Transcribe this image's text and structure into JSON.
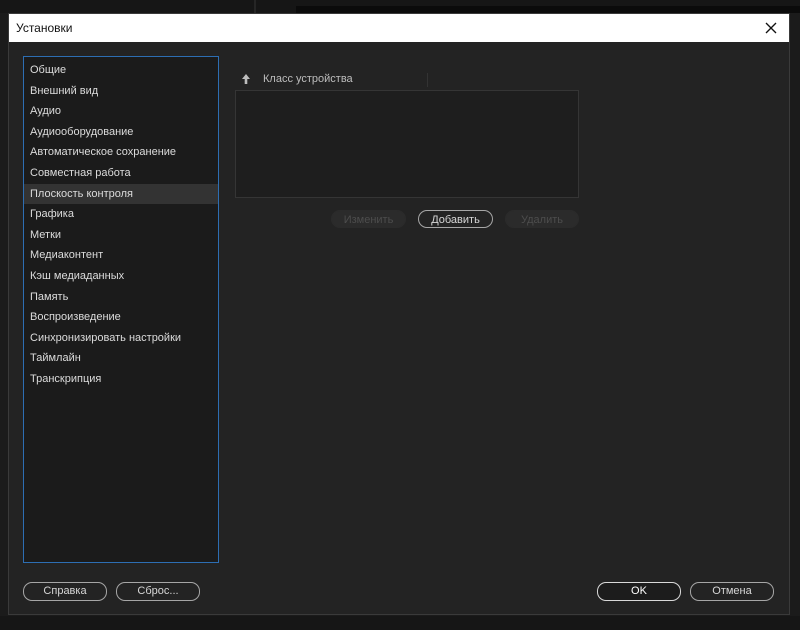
{
  "dialog": {
    "title": "Установки",
    "close_icon": "close-icon"
  },
  "categories": [
    {
      "label": "Общие",
      "selected": false
    },
    {
      "label": "Внешний вид",
      "selected": false
    },
    {
      "label": "Аудио",
      "selected": false
    },
    {
      "label": "Аудиооборудование",
      "selected": false
    },
    {
      "label": "Автоматическое сохранение",
      "selected": false
    },
    {
      "label": "Совместная работа",
      "selected": false
    },
    {
      "label": "Плоскость контроля",
      "selected": true
    },
    {
      "label": "Графика",
      "selected": false
    },
    {
      "label": "Метки",
      "selected": false
    },
    {
      "label": "Медиаконтент",
      "selected": false
    },
    {
      "label": "Кэш медиаданных",
      "selected": false
    },
    {
      "label": "Память",
      "selected": false
    },
    {
      "label": "Воспроизведение",
      "selected": false
    },
    {
      "label": "Синхронизировать настройки",
      "selected": false
    },
    {
      "label": "Таймлайн",
      "selected": false
    },
    {
      "label": "Транскрипция",
      "selected": false
    }
  ],
  "control_surface": {
    "column_header": "Класс устройства",
    "sort_icon": "sort-arrow-up-icon",
    "buttons": {
      "edit": "Изменить",
      "add": "Добавить",
      "remove": "Удалить"
    }
  },
  "footer": {
    "help": "Справка",
    "reset": "Сброс...",
    "ok": "OK",
    "cancel": "Отмена"
  },
  "colors": {
    "dialog_bg": "#232323",
    "titlebar_bg": "#ffffff",
    "list_border_accent": "#2d6eb3",
    "selected_item_bg": "#333333"
  }
}
